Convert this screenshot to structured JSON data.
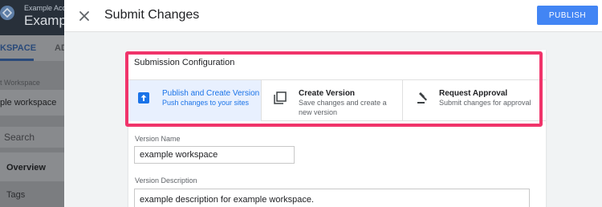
{
  "background_app": {
    "account_name": "Example Acc",
    "container_name": "Exampl",
    "tab_workspace": "KSPACE",
    "tab_admin": "AD",
    "current_workspace_label": "t Workspace",
    "current_workspace_value": "ple workspace",
    "search_placeholder": "Search",
    "nav_overview": "Overview",
    "nav_tags": "Tags"
  },
  "header": {
    "title": "Submit Changes",
    "publish_label": "PUBLISH",
    "close_icon": "close-icon"
  },
  "submission": {
    "section_title": "Submission Configuration",
    "options": [
      {
        "title": "Publish and Create Version",
        "description": "Push changes to your sites",
        "icon": "publish-icon",
        "selected": true
      },
      {
        "title": "Create Version",
        "description": "Save changes and create a new version",
        "icon": "copy-icon",
        "selected": false
      },
      {
        "title": "Request Approval",
        "description": "Submit changes for approval",
        "icon": "gavel-icon",
        "selected": false
      }
    ]
  },
  "form": {
    "version_name_label": "Version Name",
    "version_name_value": "example workspace",
    "version_description_label": "Version Description",
    "version_description_value": "example description for example workspace."
  },
  "colors": {
    "accent": "#4285f4",
    "selected_bg": "#e8f0fe",
    "highlight": "#f0346a"
  }
}
